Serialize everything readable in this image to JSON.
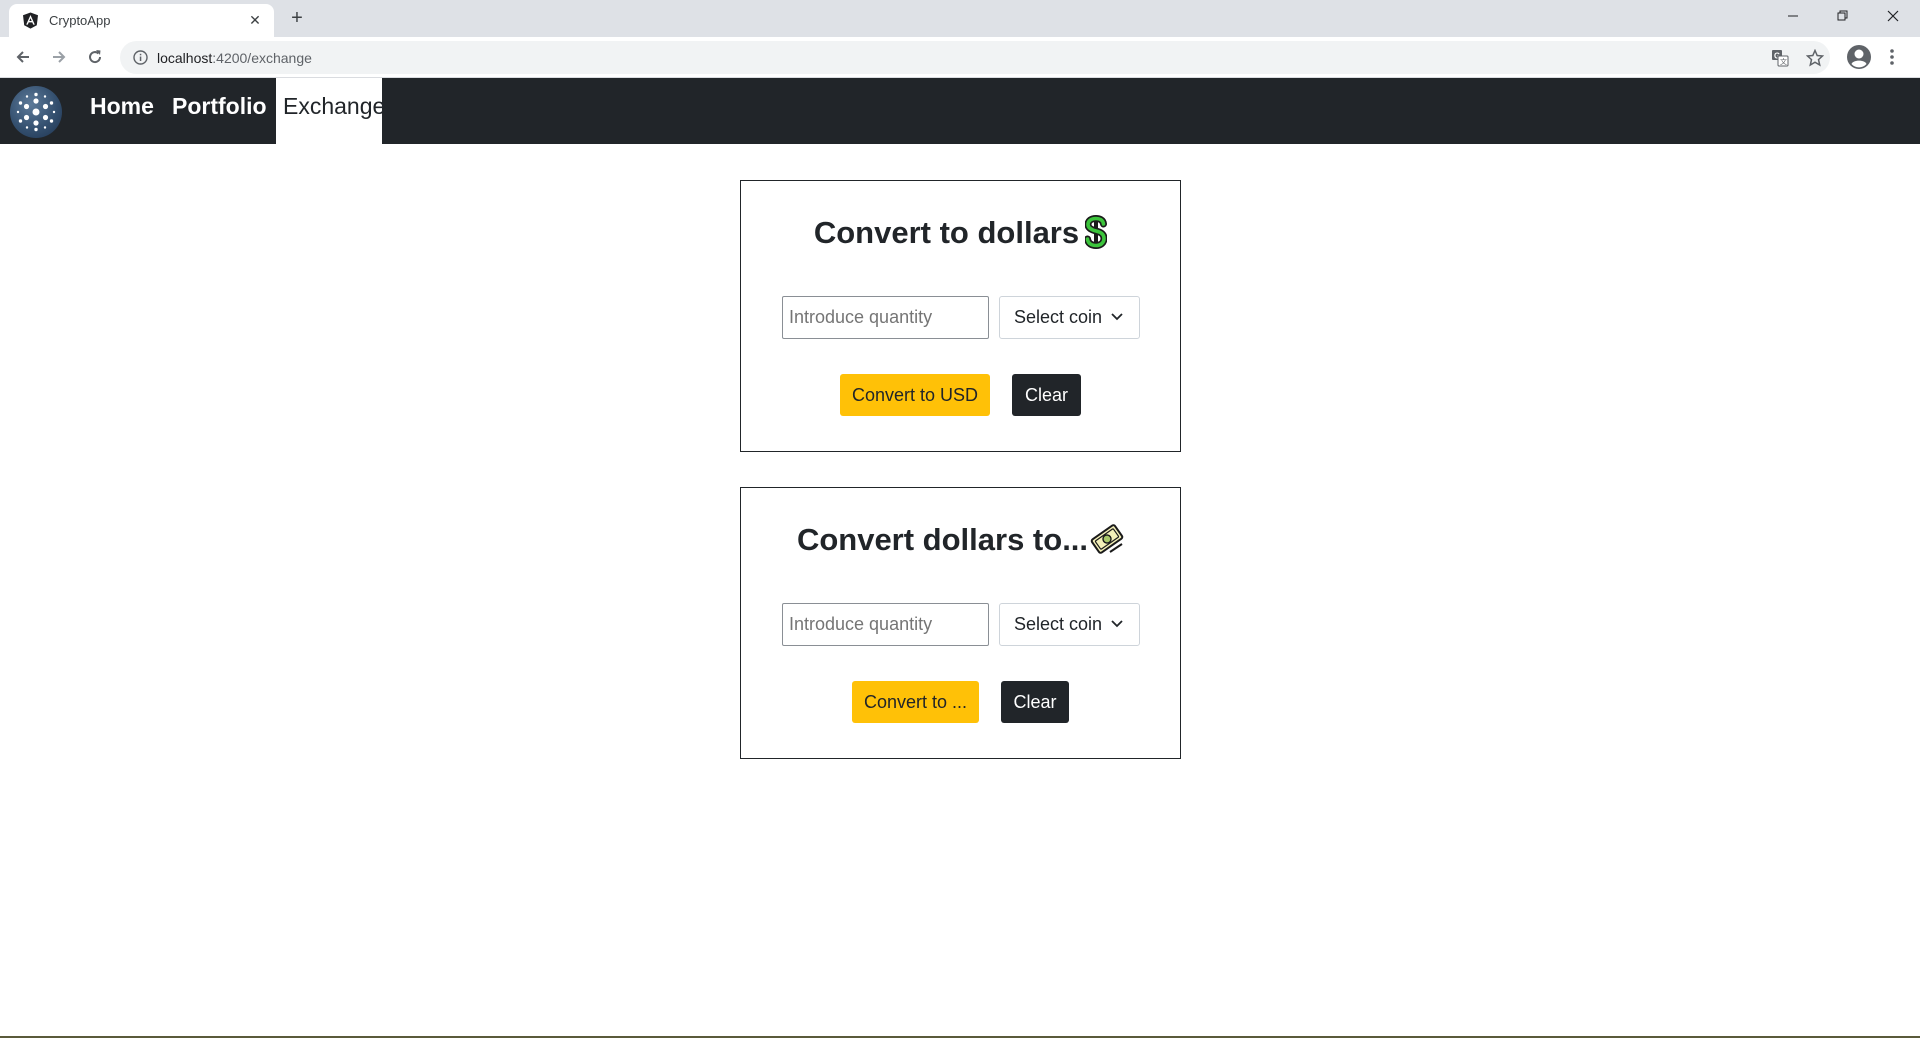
{
  "browser": {
    "tab_title": "CryptoApp",
    "new_tab_symbol": "+",
    "close_symbol": "✕",
    "url_host": "localhost",
    "url_path": ":4200/exchange"
  },
  "navbar": {
    "links": [
      {
        "label": "Home"
      },
      {
        "label": "Portfolio"
      },
      {
        "label": "Exchange"
      }
    ],
    "active": "Exchange"
  },
  "cards": [
    {
      "title": "Convert to dollars",
      "title_icon": "dollar-sign-icon",
      "quantity_placeholder": "Introduce quantity",
      "select_value": "Select coin",
      "primary_button": "Convert to USD",
      "secondary_button": "Clear"
    },
    {
      "title": "Convert dollars to...",
      "title_icon": "money-bill-icon",
      "quantity_placeholder": "Introduce quantity",
      "select_value": "Select coin",
      "primary_button": "Convert to ...",
      "secondary_button": "Clear"
    }
  ],
  "colors": {
    "navbar_bg": "#212529",
    "primary_button": "#ffc107",
    "secondary_button": "#212529"
  }
}
